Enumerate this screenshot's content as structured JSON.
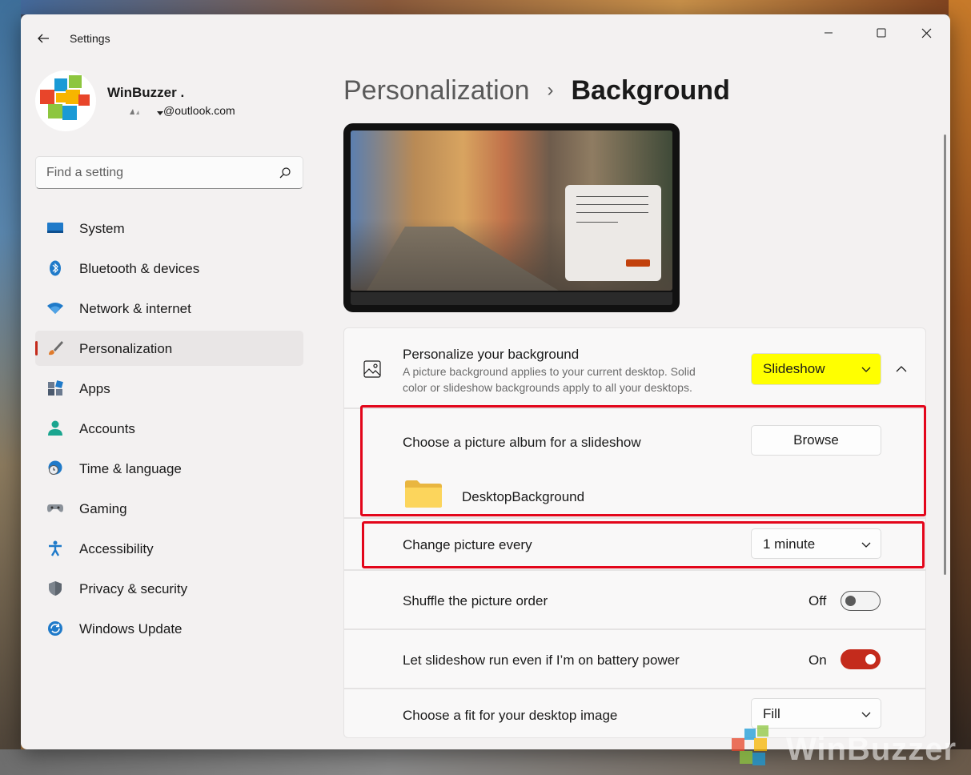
{
  "window": {
    "title": "Settings"
  },
  "user": {
    "name": "WinBuzzer .",
    "email": "@outlook.com"
  },
  "search": {
    "placeholder": "Find a setting"
  },
  "nav": [
    {
      "label": "System",
      "icon": "system-icon"
    },
    {
      "label": "Bluetooth & devices",
      "icon": "bluetooth-icon"
    },
    {
      "label": "Network & internet",
      "icon": "network-icon"
    },
    {
      "label": "Personalization",
      "icon": "brush-icon",
      "active": true
    },
    {
      "label": "Apps",
      "icon": "apps-icon"
    },
    {
      "label": "Accounts",
      "icon": "accounts-icon"
    },
    {
      "label": "Time & language",
      "icon": "clock-globe-icon"
    },
    {
      "label": "Gaming",
      "icon": "gamepad-icon"
    },
    {
      "label": "Accessibility",
      "icon": "accessibility-icon"
    },
    {
      "label": "Privacy & security",
      "icon": "shield-icon"
    },
    {
      "label": "Windows Update",
      "icon": "update-icon"
    }
  ],
  "breadcrumb": {
    "parent": "Personalization",
    "separator": "›",
    "current": "Background"
  },
  "personalize": {
    "title": "Personalize your background",
    "description_line1": "A picture background applies to your current desktop. Solid",
    "description_line2": "color or slideshow backgrounds apply to all your desktops.",
    "value": "Slideshow"
  },
  "album": {
    "label": "Choose a picture album for a slideshow",
    "browse": "Browse",
    "folder": "DesktopBackground"
  },
  "interval": {
    "label": "Change picture every",
    "value": "1 minute"
  },
  "shuffle": {
    "label": "Shuffle the picture order",
    "state": "Off"
  },
  "battery": {
    "label": "Let slideshow run even if I’m on battery power",
    "state": "On"
  },
  "fit": {
    "label": "Choose a fit for your desktop image",
    "value": "Fill"
  },
  "watermark": {
    "text": "WinBuzzer"
  },
  "colors": {
    "accent": "#c42b1c",
    "highlight": "#ffff00",
    "annotation": "#e3061b"
  }
}
